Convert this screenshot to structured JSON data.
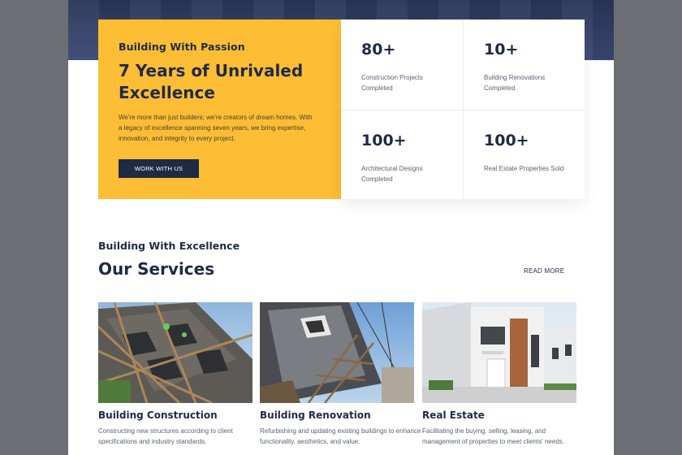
{
  "intro": {
    "kicker": "Building With Passion",
    "title": "7 Years of Unrivaled Excellence",
    "text": "We're more than just builders; we're creators of dream homes. With a legacy of excellence spanning seven years, we bring expertise, innovation, and integrity to every project.",
    "button": "WORK WITH US"
  },
  "stats": [
    {
      "number": "80+",
      "label": "Construction Projects Completed"
    },
    {
      "number": "10+",
      "label": "Building Renovations Completed"
    },
    {
      "number": "100+",
      "label": "Architectural Designs Completed"
    },
    {
      "number": "100+",
      "label": "Real Estate Properties Sold"
    }
  ],
  "services": {
    "kicker": "Building With Excellence",
    "title": "Our Services",
    "read_more": "READ MORE",
    "cards": [
      {
        "title": "Building Construction",
        "desc": "Constructing new structures according to client specifications and industry standards."
      },
      {
        "title": "Building Renovation",
        "desc": "Refurbishing and updating existing buildings to enhance functionality, aesthetics, and value."
      },
      {
        "title": "Real Estate",
        "desc": "Facilitating the buying, selling, leasing, and management of properties to meet clients' needs."
      }
    ]
  },
  "colors": {
    "accent": "#fdbd34",
    "navy": "#1f2a44"
  }
}
